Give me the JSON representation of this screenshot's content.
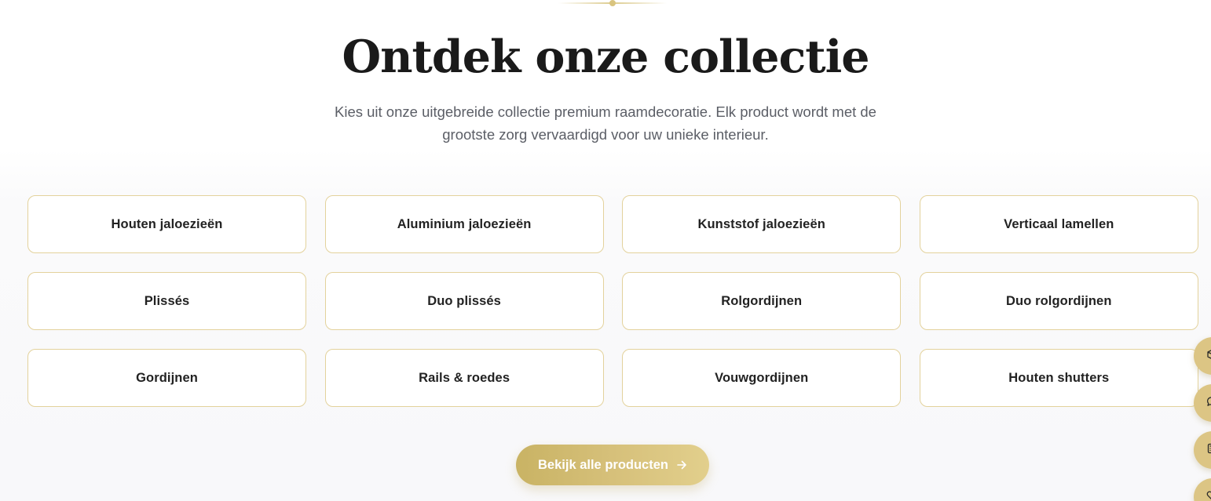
{
  "section": {
    "title": "Ontdek onze collectie",
    "subtitle_line1": "Kies uit onze uitgebreide collectie premium raamdecoratie. Elk product wordt met de",
    "subtitle_line2": "grootste zorg vervaardigd voor uw unieke interieur."
  },
  "categories": [
    {
      "label": "Houten jaloezieën"
    },
    {
      "label": "Aluminium jaloezieën"
    },
    {
      "label": "Kunststof jaloezieën"
    },
    {
      "label": "Verticaal lamellen"
    },
    {
      "label": "Plissés"
    },
    {
      "label": "Duo plissés"
    },
    {
      "label": "Rolgordijnen"
    },
    {
      "label": "Duo rolgordijnen"
    },
    {
      "label": "Gordijnen"
    },
    {
      "label": "Rails & roedes"
    },
    {
      "label": "Vouwgordijnen"
    },
    {
      "label": "Houten shutters"
    }
  ],
  "cta": {
    "label": "Bekijk alle producten",
    "icon": "arrow-right-icon"
  },
  "side_buttons": [
    {
      "icon": "box-icon"
    },
    {
      "icon": "chat-icon"
    },
    {
      "icon": "calculator-icon"
    },
    {
      "icon": "heart-icon"
    }
  ],
  "colors": {
    "accent_gold": "#d6c07a",
    "card_border": "#e3d29c",
    "title": "#1a1a1a",
    "subtitle": "#5b5e66"
  }
}
